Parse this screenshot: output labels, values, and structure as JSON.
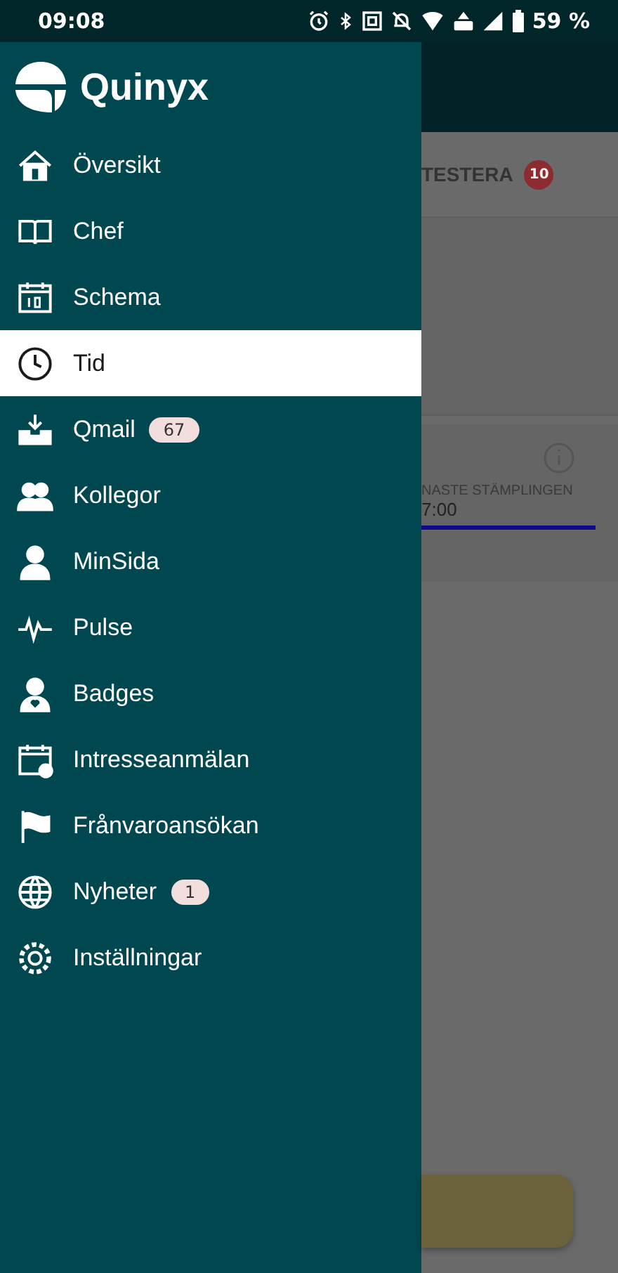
{
  "status_bar": {
    "time": "09:08",
    "battery": "59 %"
  },
  "brand": {
    "name": "Quinyx"
  },
  "menu": [
    {
      "label": "Översikt",
      "selected": false
    },
    {
      "label": "Chef",
      "selected": false
    },
    {
      "label": "Schema",
      "selected": false
    },
    {
      "label": "Tid",
      "selected": true
    },
    {
      "label": "Qmail",
      "selected": false,
      "badge": "67"
    },
    {
      "label": "Kollegor",
      "selected": false
    },
    {
      "label": "MinSida",
      "selected": false
    },
    {
      "label": "Pulse",
      "selected": false
    },
    {
      "label": "Badges",
      "selected": false
    },
    {
      "label": "Intresseanmälan",
      "selected": false
    },
    {
      "label": "Frånvaroansökan",
      "selected": false
    },
    {
      "label": "Nyheter",
      "selected": false,
      "badge": "1"
    },
    {
      "label": "Inställningar",
      "selected": false
    }
  ],
  "background": {
    "tab": {
      "label": "TESTERA",
      "badge": "10"
    },
    "card": {
      "label": "NASTE STÄMPLINGEN",
      "value": "7:00"
    }
  }
}
